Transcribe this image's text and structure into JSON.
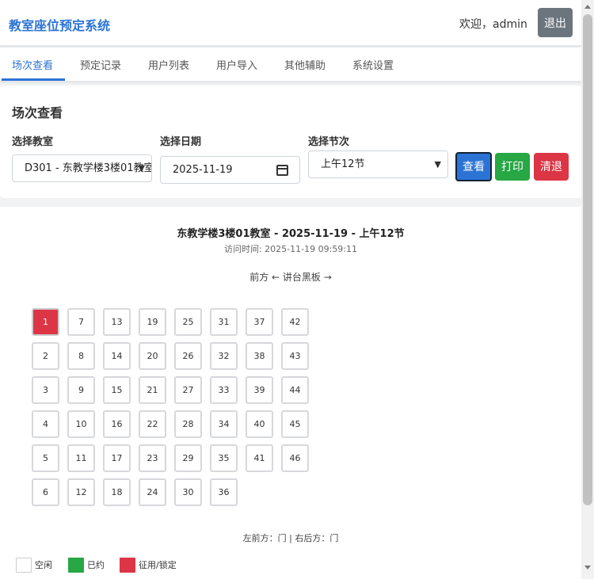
{
  "header": {
    "title": "教室座位预定系统",
    "welcome": "欢迎，admin",
    "logout_label": "退出"
  },
  "nav": {
    "tabs": [
      {
        "label": "场次查看",
        "active": true
      },
      {
        "label": "预定记录"
      },
      {
        "label": "用户列表"
      },
      {
        "label": "用户导入"
      },
      {
        "label": "其他辅助"
      },
      {
        "label": "系统设置"
      }
    ]
  },
  "filter": {
    "section_title": "场次查看",
    "classroom_label": "选择教室",
    "classroom_value": "D301 - 东教学楼3楼01教室",
    "date_label": "选择日期",
    "date_value": "2025-11-19",
    "period_label": "选择节次",
    "period_value": "上午12节",
    "view_label": "查看",
    "print_label": "打印",
    "clear_label": "清退"
  },
  "seatmap": {
    "title": "东教学楼3楼01教室 - 2025-11-19 - 上午12节",
    "access_time": "访问时间: 2025-11-19 09:59:11",
    "front_label": "前方 ← 讲台黑板 →",
    "door_note": "左前方：门 | 右后方：门",
    "columns": [
      [
        1,
        2,
        3,
        4,
        5,
        6
      ],
      [
        7,
        8,
        9,
        10,
        11,
        12
      ],
      [
        13,
        14,
        15,
        16,
        17,
        18
      ],
      [
        19,
        20,
        21,
        22,
        23,
        24
      ],
      [
        25,
        26,
        27,
        28,
        29,
        30
      ],
      [
        31,
        32,
        33,
        34,
        35,
        36
      ],
      [
        37,
        38,
        39,
        40,
        41
      ],
      [
        42,
        43,
        44,
        45,
        46
      ]
    ],
    "occupied_seats": [
      1
    ],
    "legend": [
      {
        "label": "空闲",
        "color": "#ffffff"
      },
      {
        "label": "已约",
        "color": "#28a745"
      },
      {
        "label": "征用/锁定",
        "color": "#dc3545"
      }
    ]
  }
}
